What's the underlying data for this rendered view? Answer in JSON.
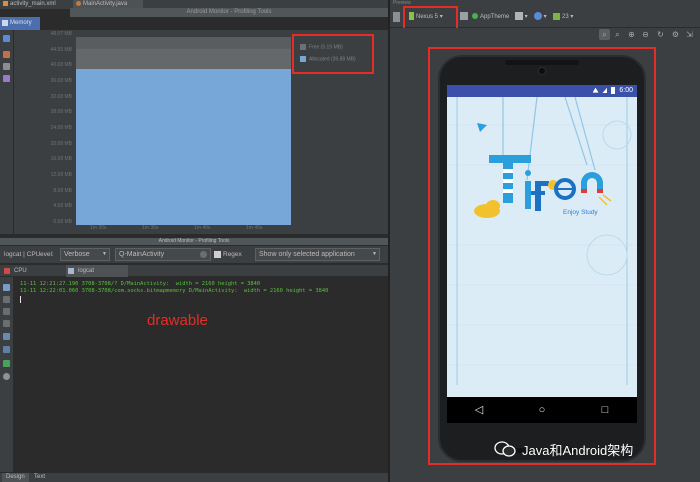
{
  "editor_tabs": [
    {
      "label": "activity_main.xml"
    },
    {
      "label": "MainActivity.java"
    }
  ],
  "memory_monitor": {
    "title": "Android Monitor - Profiling Tools",
    "tab_label": "Memory",
    "y_ticks": [
      "48.07 MB",
      "44.55 MB",
      "40.08 MB",
      "36.08 MB",
      "32.08 MB",
      "28.08 MB",
      "24.08 MB",
      "20.08 MB",
      "16.08 MB",
      "12.08 MB",
      "8.08 MB",
      "4.08 MB",
      "0.08 MB"
    ],
    "x_ticks": [
      "1m 30s",
      "1m 35s",
      "1m 40s",
      "1m 45s"
    ],
    "legend": {
      "free": "Free (5.19 MB)",
      "allocated": "Allocated (39.88 MB)"
    },
    "colors": {
      "free": "#5a5d5f",
      "allocated": "#77a7d9",
      "annotation": "#e52d27"
    }
  },
  "chart_data": {
    "type": "area",
    "title": "",
    "xlabel": "",
    "ylabel": "",
    "x": [
      "1m 30s",
      "1m 35s",
      "1m 40s",
      "1m 45s"
    ],
    "series": [
      {
        "name": "Allocated (39.88 MB)",
        "values": [
          39.88,
          39.88,
          39.88,
          39.88
        ]
      },
      {
        "name": "Free (5.19 MB)",
        "values": [
          5.19,
          5.19,
          5.19,
          5.19
        ]
      }
    ],
    "ylim": [
      0,
      48.07
    ],
    "legend": "top-right"
  },
  "logcat": {
    "title": "Android Monitor - Profiling Tools",
    "label": "logcat | CPU",
    "level_label": "evel:",
    "level_value": "Verbose",
    "filter_value": "Q-MainActivity",
    "regex_label": "Regex",
    "filter_mode": "Show only selected application",
    "subtab_cpu": "CPU",
    "subtab_logcat": "logcat",
    "lines": [
      "11-11 12:21:27.190 3708-3708/? D/MainActivity:  width = 2160 height = 3840",
      "11-11 12:22:01.060 3708-3708/com.socks.bitmapmemory D/MainActivity:  width = 2160 height = 3840"
    ],
    "annotation": "drawable",
    "bottom_tabs": [
      "Design",
      "Text"
    ]
  },
  "preview": {
    "header": "Preview",
    "device": "Nexus 5",
    "theme": "AppTheme",
    "api": "23",
    "status_time": "6:00",
    "app_tagline": "Enjoy Study"
  },
  "watermark": "Java和Android架构"
}
